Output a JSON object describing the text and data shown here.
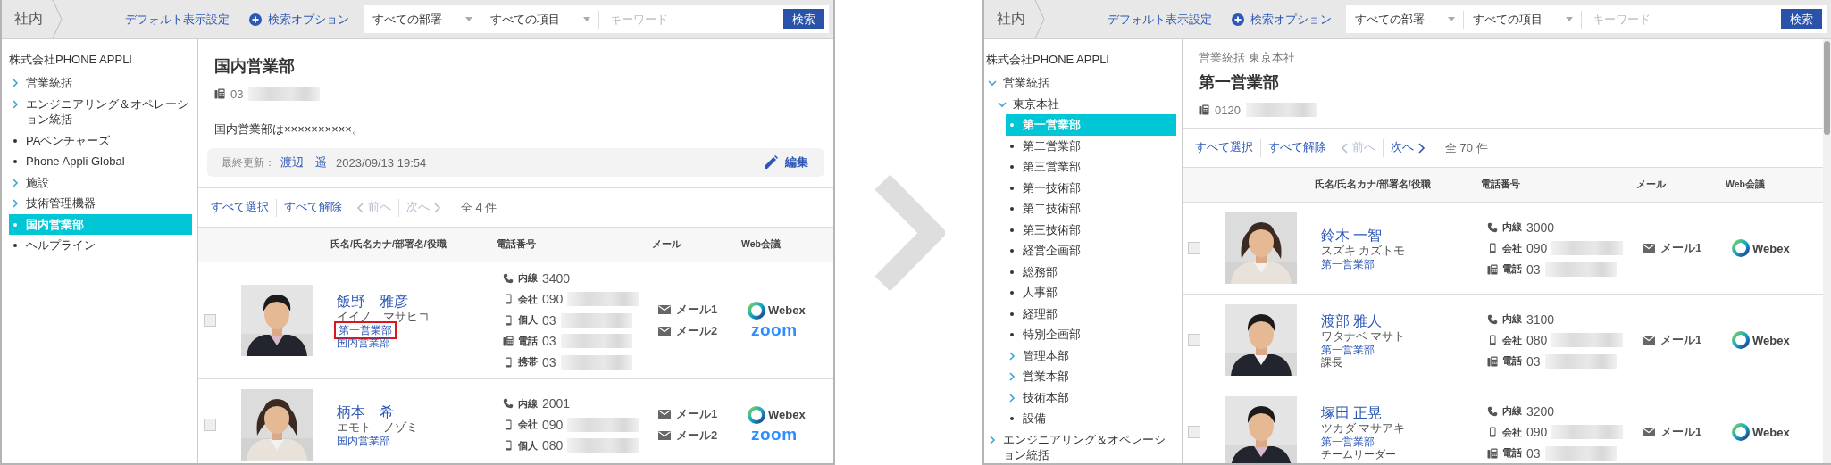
{
  "panels": [
    {
      "breadcrumb": "社内",
      "scrollbar": false,
      "toolbar": {
        "default_view": "デフォルト表示設定",
        "search_options": "検索オプション",
        "department_filter": "すべての部署",
        "field_filter": "すべての項目",
        "keyword": {
          "placeholder": "キーワード"
        },
        "search_button": "検索"
      },
      "sidebar": {
        "company": "株式会社PHONE APPLI",
        "items": [
          {
            "label": "営業統括",
            "kind": "folder",
            "expanded": false,
            "selected": false
          },
          {
            "label": "エンジニアリング＆オペレーション統括",
            "kind": "folder",
            "expanded": false,
            "selected": false
          },
          {
            "label": "PAベンチャーズ",
            "kind": "leaf",
            "selected": false
          },
          {
            "label": "Phone Appli Global",
            "kind": "leaf",
            "selected": false
          },
          {
            "label": "施設",
            "kind": "folder",
            "expanded": false,
            "selected": false
          },
          {
            "label": "技術管理機器",
            "kind": "folder",
            "expanded": false,
            "selected": false
          },
          {
            "label": "国内営業部",
            "kind": "leaf",
            "selected": true
          },
          {
            "label": "ヘルプライン",
            "kind": "leaf",
            "selected": false
          }
        ]
      },
      "department": {
        "name": "国内営業部",
        "phone": {
          "number": "03",
          "redacted": true
        },
        "description": "国内営業部は××××××××××。",
        "update": {
          "label": "最終更新：",
          "user": "渡辺　遥",
          "time": "2023/09/13 19:54",
          "edit_button": "編集"
        }
      },
      "pager": {
        "select_all": "すべて選択",
        "clear_all": "すべて解除",
        "prev": "前へ",
        "prev_disabled": true,
        "next": "次へ",
        "next_disabled": true,
        "total": "全 4 件"
      },
      "table": {
        "columns": [
          "氏名/氏名カナ/部署名/役職",
          "電話番号",
          "メール",
          "Web会議"
        ],
        "rows": [
          {
            "checked": false,
            "name": "飯野　雅彦",
            "kana": "イイノ　マサヒコ",
            "departments": [
              {
                "text": "第一営業部",
                "highlighted": true
              },
              {
                "text": "国内営業部",
                "highlighted": false
              }
            ],
            "phones": [
              {
                "kind": "extension",
                "label": "内線",
                "number": "3400",
                "redacted": false
              },
              {
                "kind": "mobile",
                "label": "会社",
                "number": "090",
                "redacted": true
              },
              {
                "kind": "mobile",
                "label": "個人",
                "number": "03",
                "redacted": true
              },
              {
                "kind": "desk",
                "label": "電話",
                "number": "03",
                "redacted": true
              },
              {
                "kind": "mobile",
                "label": "携帯",
                "number": "03",
                "redacted": true
              }
            ],
            "mails": [
              "メール1",
              "メール2"
            ],
            "meetings": [
              {
                "kind": "webex",
                "label": "Webex"
              },
              {
                "kind": "zoom",
                "label": "zoom"
              }
            ]
          },
          {
            "checked": false,
            "name": "柄本　希",
            "kana": "エモト　ノゾミ",
            "departments": [
              {
                "text": "国内営業部",
                "highlighted": false
              }
            ],
            "phones": [
              {
                "kind": "extension",
                "label": "内線",
                "number": "2001",
                "redacted": false
              },
              {
                "kind": "mobile",
                "label": "会社",
                "number": "090",
                "redacted": true
              },
              {
                "kind": "mobile",
                "label": "個人",
                "number": "080",
                "redacted": true
              }
            ],
            "mails": [
              "メール1",
              "メール2"
            ],
            "meetings": [
              {
                "kind": "webex",
                "label": "Webex"
              },
              {
                "kind": "zoom",
                "label": "zoom"
              }
            ]
          }
        ]
      }
    },
    {
      "breadcrumb": "社内",
      "scrollbar": true,
      "toolbar": {
        "default_view": "デフォルト表示設定",
        "search_options": "検索オプション",
        "department_filter": "すべての部署",
        "field_filter": "すべての項目",
        "keyword": {
          "placeholder": "キーワード"
        },
        "search_button": "検索"
      },
      "sidebar": {
        "company": "株式会社PHONE APPLI",
        "items": [
          {
            "label": "営業統括",
            "kind": "folder",
            "expanded": true,
            "selected": false,
            "children": [
              {
                "label": "東京本社",
                "kind": "folder",
                "expanded": true,
                "selected": false,
                "children": [
                  {
                    "label": "第一営業部",
                    "kind": "leaf",
                    "selected": true
                  },
                  {
                    "label": "第二営業部",
                    "kind": "leaf",
                    "selected": false
                  },
                  {
                    "label": "第三営業部",
                    "kind": "leaf",
                    "selected": false
                  },
                  {
                    "label": "第一技術部",
                    "kind": "leaf",
                    "selected": false
                  },
                  {
                    "label": "第二技術部",
                    "kind": "leaf",
                    "selected": false
                  },
                  {
                    "label": "第三技術部",
                    "kind": "leaf",
                    "selected": false
                  },
                  {
                    "label": "経営企画部",
                    "kind": "leaf",
                    "selected": false
                  },
                  {
                    "label": "総務部",
                    "kind": "leaf",
                    "selected": false
                  },
                  {
                    "label": "人事部",
                    "kind": "leaf",
                    "selected": false
                  },
                  {
                    "label": "経理部",
                    "kind": "leaf",
                    "selected": false
                  },
                  {
                    "label": "特別企画部",
                    "kind": "leaf",
                    "selected": false
                  },
                  {
                    "label": "管理本部",
                    "kind": "folder",
                    "expanded": false,
                    "selected": false
                  },
                  {
                    "label": "営業本部",
                    "kind": "folder",
                    "expanded": false,
                    "selected": false
                  },
                  {
                    "label": "技術本部",
                    "kind": "folder",
                    "expanded": false,
                    "selected": false
                  },
                  {
                    "label": "設備",
                    "kind": "leaf",
                    "selected": false
                  }
                ]
              }
            ]
          },
          {
            "label": "エンジニアリング＆オペレーション統括",
            "kind": "folder",
            "expanded": false,
            "selected": false
          }
        ]
      },
      "department": {
        "path": "営業統括 東京本社",
        "name": "第一営業部",
        "phone": {
          "number": "0120",
          "redacted": true
        }
      },
      "pager": {
        "select_all": "すべて選択",
        "clear_all": "すべて解除",
        "prev": "前へ",
        "prev_disabled": true,
        "next": "次へ",
        "next_disabled": false,
        "total": "全 70 件"
      },
      "table": {
        "columns": [
          "氏名/氏名カナ/部署名/役職",
          "電話番号",
          "メール",
          "Web会議"
        ],
        "rows": [
          {
            "checked": false,
            "name": "鈴木 一智",
            "kana": "スズキ カズトモ",
            "departments": [
              {
                "text": "第一営業部",
                "highlighted": false
              }
            ],
            "phones": [
              {
                "kind": "extension",
                "label": "内線",
                "number": "3000",
                "redacted": false
              },
              {
                "kind": "mobile",
                "label": "会社",
                "number": "090",
                "redacted": true
              },
              {
                "kind": "desk",
                "label": "電話",
                "number": "03",
                "redacted": true
              }
            ],
            "mails": [
              "メール1"
            ],
            "meetings": [
              {
                "kind": "webex",
                "label": "Webex"
              }
            ]
          },
          {
            "checked": false,
            "name": "渡部 雅人",
            "kana": "ワタナベ マサト",
            "departments": [
              {
                "text": "第一営業部",
                "highlighted": false
              }
            ],
            "title": "課長",
            "phones": [
              {
                "kind": "extension",
                "label": "内線",
                "number": "3100",
                "redacted": false
              },
              {
                "kind": "mobile",
                "label": "会社",
                "number": "080",
                "redacted": true
              },
              {
                "kind": "desk",
                "label": "電話",
                "number": "03",
                "redacted": true
              }
            ],
            "mails": [
              "メール1"
            ],
            "meetings": [
              {
                "kind": "webex",
                "label": "Webex"
              }
            ]
          },
          {
            "checked": false,
            "name": "塚田 正晃",
            "kana": "ツカダ マサアキ",
            "departments": [
              {
                "text": "第一営業部",
                "highlighted": false
              }
            ],
            "title": "チームリーダー",
            "phones": [
              {
                "kind": "extension",
                "label": "内線",
                "number": "3200",
                "redacted": false
              },
              {
                "kind": "mobile",
                "label": "会社",
                "number": "090",
                "redacted": true
              },
              {
                "kind": "desk",
                "label": "電話",
                "number": "03",
                "redacted": true
              }
            ],
            "mails": [
              "メール1"
            ],
            "meetings": [
              {
                "kind": "webex",
                "label": "Webex"
              }
            ]
          }
        ]
      }
    }
  ]
}
